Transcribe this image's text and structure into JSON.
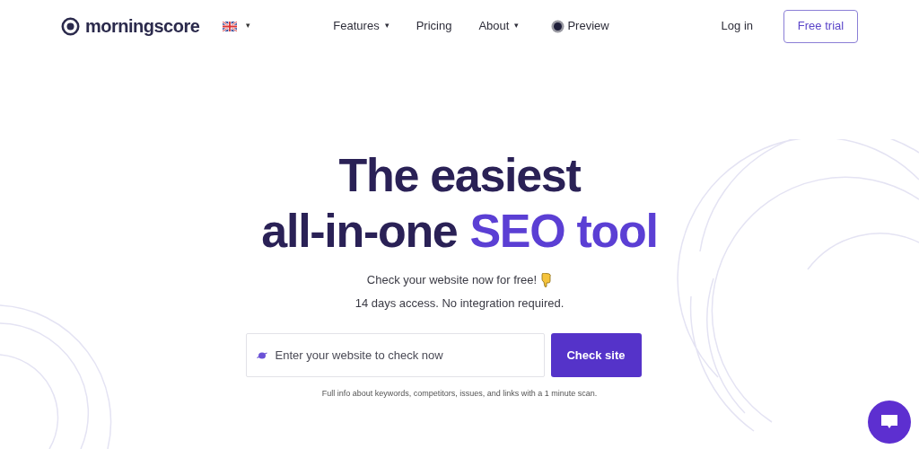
{
  "header": {
    "logo": "morningscore",
    "language_dropdown": {
      "caret": "▾"
    },
    "nav": [
      {
        "label": "Features",
        "dropdown": true,
        "kind": "link"
      },
      {
        "label": "Pricing",
        "dropdown": false,
        "kind": "link"
      },
      {
        "label": "About",
        "dropdown": true,
        "kind": "link"
      },
      {
        "label": "Preview",
        "dropdown": false,
        "kind": "preview"
      }
    ],
    "caret": "▾",
    "login": "Log in",
    "cta": "Free trial"
  },
  "hero": {
    "headline": [
      [
        {
          "text": "The easiest",
          "accent": false
        }
      ],
      [
        {
          "text": "all-in-one",
          "accent": false
        },
        {
          "text": "SEO tool",
          "accent": true
        }
      ]
    ],
    "subtitle": "Check your website now for free!",
    "subtitle_2": "14 days access. No integration required.",
    "search": {
      "placeholder": "Enter your website to check now"
    },
    "button": "Check site",
    "footnote": "Full info about keywords, competitors, issues, and links with a 1 minute scan."
  }
}
